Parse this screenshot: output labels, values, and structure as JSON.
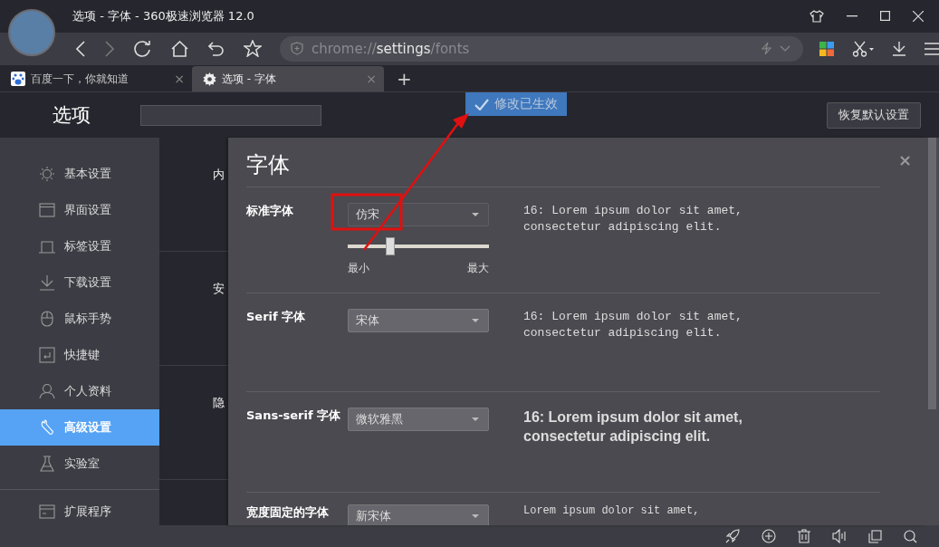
{
  "window": {
    "title": "选项 - 字体 - 360极速浏览器 12.0"
  },
  "address_bar": {
    "scheme": "chrome://",
    "host": "settings",
    "path": "/fonts"
  },
  "tabs": [
    {
      "label": "百度一下，你就知道",
      "close": "×",
      "selected": false,
      "kind": "paw"
    },
    {
      "label": "选项 - 字体",
      "close": "×",
      "selected": true,
      "kind": "gear"
    }
  ],
  "new_tab": "+",
  "header": {
    "title": "选项",
    "toast": "修改已生效",
    "restore_button": "恢复默认设置"
  },
  "sidebar": {
    "items": [
      {
        "label": "基本设置",
        "selected": false
      },
      {
        "label": "界面设置",
        "selected": false
      },
      {
        "label": "标签设置",
        "selected": false
      },
      {
        "label": "下载设置",
        "selected": false
      },
      {
        "label": "鼠标手势",
        "selected": false
      },
      {
        "label": "快捷键",
        "selected": false
      },
      {
        "label": "个人资料",
        "selected": false
      },
      {
        "label": "高级设置",
        "selected": true
      },
      {
        "label": "实验室",
        "selected": false
      }
    ],
    "extra_items": [
      {
        "label": "扩展程序",
        "selected": false
      }
    ]
  },
  "background_sections": [
    "内",
    "安",
    "隐"
  ],
  "dialog": {
    "title": "字体",
    "close": "×",
    "rows": [
      {
        "label": "标准字体",
        "font": "仿宋",
        "sample": "16: Lorem ipsum dolor sit amet, consectetur adipiscing elit.",
        "kind": "mono",
        "slider": {
          "level": 0.3,
          "min_label": "最小",
          "max_label": "最大"
        }
      },
      {
        "label": "Serif 字体",
        "font": "宋体",
        "sample": "16: Lorem ipsum dolor sit amet, consectetur adipiscing elit.",
        "kind": "mono"
      },
      {
        "label": "Sans-serif 字体",
        "font": "微软雅黑",
        "sample": "16: Lorem ipsum dolor sit amet, consectetur adipiscing elit.",
        "kind": "sans"
      },
      {
        "label": "宽度固定的字体",
        "font": "新宋体",
        "sample": "Lorem ipsum dolor sit amet,",
        "kind": "mono_small"
      }
    ]
  }
}
